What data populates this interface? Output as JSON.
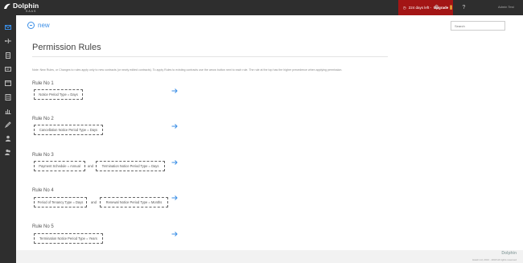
{
  "app": {
    "name": "Dolphin",
    "sub": "SAAS"
  },
  "topbar": {
    "trial_text": "224 days left -",
    "upgrade_label": "Upgrade",
    "user_name": "Admin Test"
  },
  "header": {
    "back_label": "new",
    "search_placeholder": "Search"
  },
  "page": {
    "title": "Permission Rules",
    "note": "Note: New Rules, or Changes to rules apply only to new contracts (or newly edited contracts). To apply Rules to existing contracts use the arrow button next to each rule. The rule at the top has the higher precedence when applying permission."
  },
  "rules": [
    {
      "label": "Rule No 1",
      "conditions": [
        "Notice Period Type = Days"
      ]
    },
    {
      "label": "Rule No 2",
      "conditions": [
        "Cancellation Notice Period Type = Days"
      ]
    },
    {
      "label": "Rule No 3",
      "conditions": [
        "Payment Schedule = Annual",
        "Termination Notice Period Type = Days"
      ]
    },
    {
      "label": "Rule No 4",
      "conditions": [
        "Period of Tenancy Type = Days",
        "Renewal Notice Period Type = Months"
      ]
    },
    {
      "label": "Rule No 5",
      "conditions": [
        "Termination Notice Period Type = Years"
      ]
    }
  ],
  "and_label": "and",
  "footer": {
    "logo": "Dolphin",
    "copyright": "Hawk Ltd, 2013 - 2018 All rights reserved"
  },
  "colors": {
    "accent": "#3a8ee6",
    "trial_bg": "#a31515",
    "sidebar_bg": "#2e2e2e"
  }
}
